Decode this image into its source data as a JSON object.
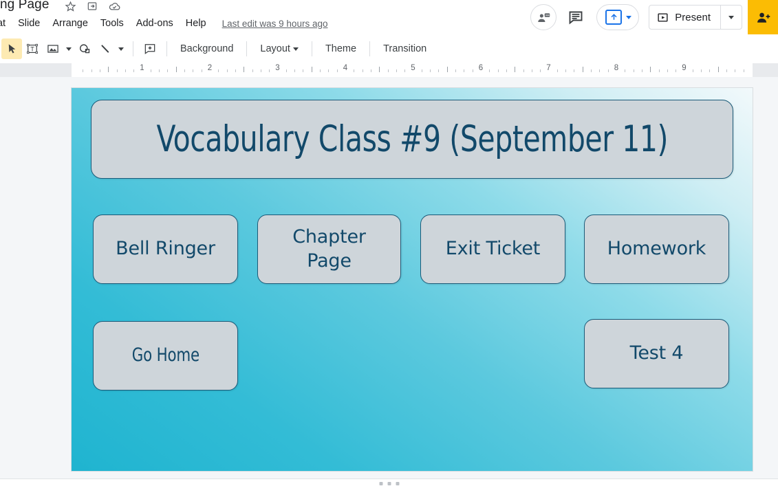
{
  "app": {
    "doc_title": "ng Page",
    "title_icons": [
      "star-icon",
      "move-to-folder-icon",
      "cloud-saved-icon"
    ],
    "menu_items": [
      "ormat",
      "Slide",
      "Arrange",
      "Tools",
      "Add-ons",
      "Help"
    ],
    "last_edit": "Last edit was 9 hours ago"
  },
  "topright": {
    "meet_icon": "present-to-meet-icon",
    "comment_icon": "comment-icon",
    "upload_icon": "upload-icon",
    "present_label": "Present",
    "present_icon": "play-box-icon",
    "share_icon": "share-person-icon",
    "share_color": "#fbbc04"
  },
  "toolbar": {
    "tools": [
      {
        "name": "select-tool",
        "icon": "cursor-arrow-icon",
        "active": true
      },
      {
        "name": "text-box-tool",
        "icon": "text-box-icon",
        "active": false
      },
      {
        "name": "insert-image-tool",
        "icon": "image-icon",
        "active": false
      },
      {
        "name": "shape-tool",
        "icon": "shape-icon",
        "active": false
      },
      {
        "name": "line-tool",
        "icon": "line-icon",
        "active": false
      },
      {
        "name": "add-comment-tool",
        "icon": "add-comment-icon",
        "active": false
      }
    ],
    "background_label": "Background",
    "layout_label": "Layout",
    "theme_label": "Theme",
    "transition_label": "Transition"
  },
  "ruler": {
    "numbers": [
      1,
      2,
      3,
      4,
      5,
      6,
      7,
      8,
      9
    ],
    "unit": "inches"
  },
  "slide": {
    "background_gradient_from": "#1fb4d0",
    "background_gradient_to": "#f2f9fb",
    "shape_fill": "#ced5da",
    "shape_border": "#1a5a78",
    "shape_text_color": "#12496a",
    "title": "Vocabulary Class #9 (September 11)",
    "buttons": [
      {
        "label": "Bell Ringer",
        "name": "bell-ringer-button",
        "narrow": false
      },
      {
        "label": "Chapter\nPage",
        "name": "chapter-page-button",
        "narrow": false
      },
      {
        "label": "Exit Ticket",
        "name": "exit-ticket-button",
        "narrow": false
      },
      {
        "label": "Homework",
        "name": "homework-button",
        "narrow": false
      },
      {
        "label": "Go Home",
        "name": "go-home-button",
        "narrow": true
      },
      {
        "label": "Test 4",
        "name": "test-4-button",
        "narrow": false
      }
    ]
  }
}
